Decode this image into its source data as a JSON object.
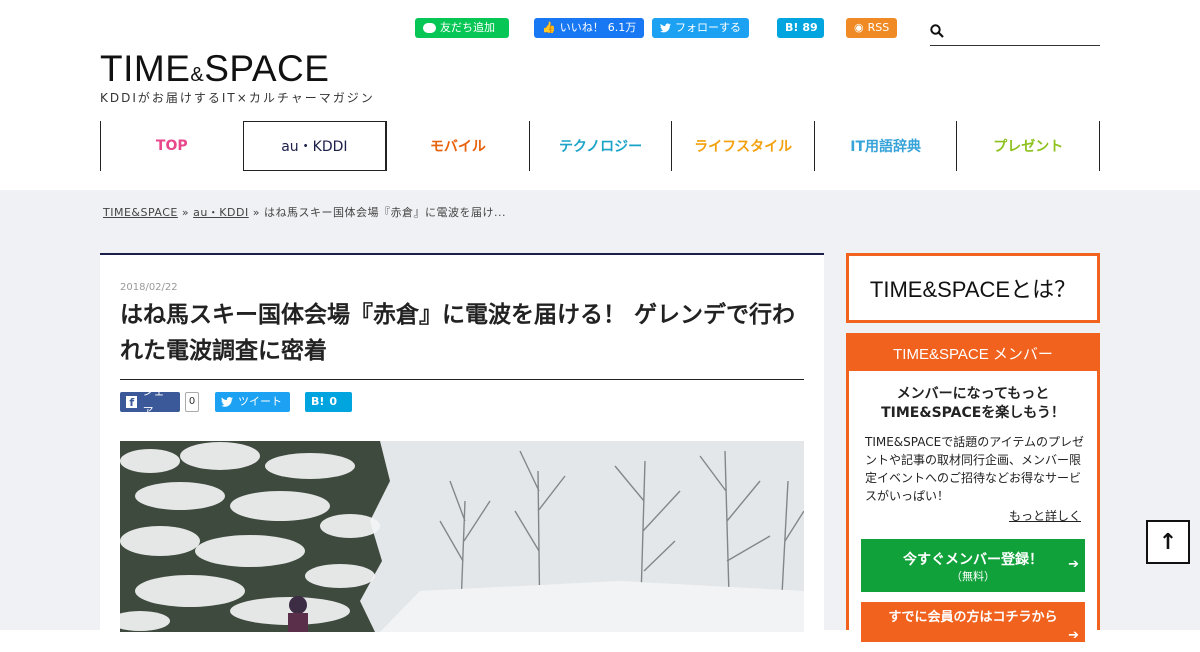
{
  "social": {
    "line": "友だち追加",
    "like_label": "いいね！",
    "like_count": "6.1万",
    "follow": "フォローする",
    "hatena_label": "B!",
    "hatena_count": "89",
    "rss": "RSS"
  },
  "search": {
    "value": "",
    "placeholder": ""
  },
  "logo": {
    "part1": "TIME",
    "amp": "&",
    "part2": "SPACE"
  },
  "tagline": "KDDIがお届けするIT×カルチャーマガジン",
  "nav": [
    {
      "label": "TOP",
      "color": "#e8478b"
    },
    {
      "label": "au・KDDI",
      "color": "#1b1f4a"
    },
    {
      "label": "モバイル",
      "color": "#e8620c"
    },
    {
      "label": "テクノロジー",
      "color": "#1ba4c8"
    },
    {
      "label": "ライフスタイル",
      "color": "#f2a10d"
    },
    {
      "label": "IT用語辞典",
      "color": "#36a3d9"
    },
    {
      "label": "プレゼント",
      "color": "#8dc21f"
    }
  ],
  "breadcrumb": {
    "home": "TIME&SPACE",
    "category": "au・KDDI",
    "current": "はね馬スキー国体会場『赤倉』に電波を届け..."
  },
  "article": {
    "date": "2018/02/22",
    "title": "はね馬スキー国体会場『赤倉』に電波を届ける！ ゲレンデで行われた電波調査に密着",
    "share_fb": "シェア",
    "share_fb_count": "0",
    "share_tw": "ツイート",
    "share_hb": "B!",
    "share_hb_count": "0"
  },
  "sidebar": {
    "about": "TIME&SPACEとは？",
    "member_head": "TIME&SPACE メンバー",
    "member_lead_1": "メンバーになってもっと",
    "member_lead_2": "TIME&SPACEを楽しもう！",
    "member_desc": "TIME&SPACEで話題のアイテムのプレゼントや記事の取材同行企画、メンバー限定イベントへのご招待などお得なサービスがいっぱい！",
    "member_more": "もっと詳しく",
    "register_label": "今すぐメンバー登録！",
    "register_sub": "（無料）",
    "login_label": "すでに会員の方はコチラから"
  },
  "accent_color": "#f0621e",
  "register_color": "#10a13b",
  "icons": [
    "line-icon",
    "facebook-icon",
    "twitter-icon",
    "rss-icon",
    "search-icon",
    "arrow-up-icon"
  ]
}
